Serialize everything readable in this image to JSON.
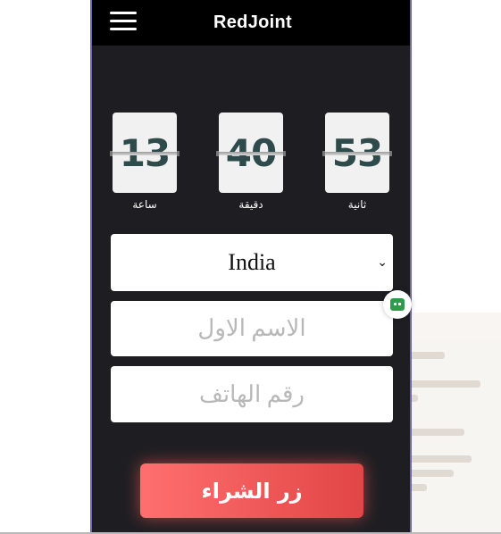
{
  "header": {
    "brand": "RedJoint",
    "menu_icon": "hamburger-icon"
  },
  "timer": {
    "hours": {
      "value": "13",
      "label": "ساعة"
    },
    "minutes": {
      "value": "40",
      "label": "دقيقة"
    },
    "seconds": {
      "value": "53",
      "label": "ثانية"
    }
  },
  "form": {
    "country": {
      "selected": "India"
    },
    "first_name": {
      "placeholder": "الاسم الاول"
    },
    "phone": {
      "placeholder": "رقم الهاتف"
    },
    "buy_label": "زر الشراء"
  },
  "widget": {
    "icon": "chat-bot-icon"
  },
  "colors": {
    "accent": "#ff5a5a",
    "dark": "#1e1e22",
    "digit": "#2f4a4b"
  }
}
